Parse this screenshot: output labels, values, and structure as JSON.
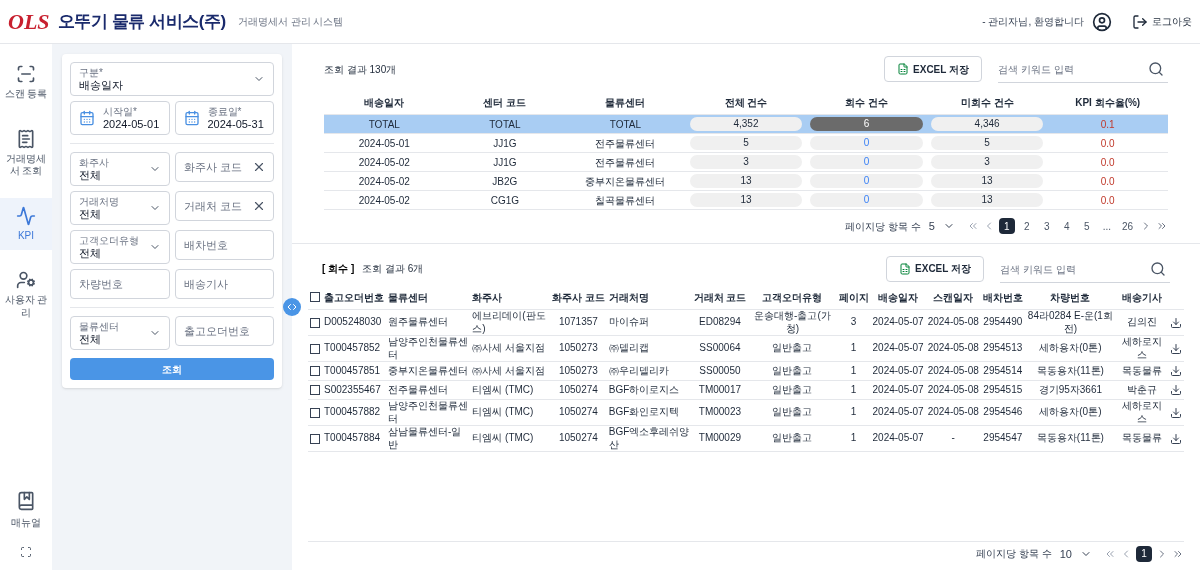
{
  "header": {
    "brand": "OLS",
    "company": "오뚜기 물류 서비스(주)",
    "subtitle": "거래명세서 관리 시스템",
    "welcome": "- 관리자님, 환영합니다",
    "logout": "로그아웃"
  },
  "nav": [
    {
      "label": "스캔 등록",
      "selected": false
    },
    {
      "label": "거래명세서 조회",
      "selected": false
    },
    {
      "label": "KPI",
      "selected": true
    },
    {
      "label": "사용자 관리",
      "selected": false
    }
  ],
  "nav_bottom": {
    "label": "매뉴얼"
  },
  "filters": {
    "groups": [
      [
        {
          "kind": "select",
          "label": "구분*",
          "value": "배송일자",
          "full": true
        },
        {
          "kind": "date",
          "label": "시작일*",
          "value": "2024-05-01"
        },
        {
          "kind": "date",
          "label": "종료일*",
          "value": "2024-05-31"
        }
      ],
      [
        {
          "kind": "select",
          "label": "화주사",
          "value": "전체"
        },
        {
          "kind": "input",
          "placeholder": "화주사 코드",
          "clearable": true
        },
        {
          "kind": "select",
          "label": "거래처명",
          "value": "전체"
        },
        {
          "kind": "input",
          "placeholder": "거래처 코드",
          "clearable": true
        },
        {
          "kind": "select",
          "label": "고객오더유형",
          "value": "전체"
        },
        {
          "kind": "input",
          "placeholder": "배차번호",
          "clearable": false
        },
        {
          "kind": "input",
          "placeholder": "차량번호",
          "clearable": false
        },
        {
          "kind": "input",
          "placeholder": "배송기사",
          "clearable": false
        }
      ],
      [
        {
          "kind": "select",
          "label": "물류센터",
          "value": "전체"
        },
        {
          "kind": "input",
          "placeholder": "출고오더번호",
          "clearable": false
        }
      ]
    ],
    "button": "조회"
  },
  "summary": {
    "result": "조회 결과 130개",
    "excel": "EXCEL 저장",
    "search_placeholder": "검색 키워드 입력",
    "columns": [
      "배송일자",
      "센터 코드",
      "물류센터",
      "전체 건수",
      "회수 건수",
      "미회수 건수",
      "KPI 회수율(%)"
    ],
    "rows": [
      {
        "selected": true,
        "cells": [
          "TOTAL",
          "TOTAL",
          "TOTAL",
          "4,352",
          "6",
          "4,346",
          "0.1"
        ]
      },
      {
        "selected": false,
        "cells": [
          "2024-05-01",
          "JJ1G",
          "전주물류센터",
          "5",
          "0",
          "5",
          "0.0"
        ]
      },
      {
        "selected": false,
        "cells": [
          "2024-05-02",
          "JJ1G",
          "전주물류센터",
          "3",
          "0",
          "3",
          "0.0"
        ]
      },
      {
        "selected": false,
        "cells": [
          "2024-05-02",
          "JB2G",
          "중부지온물류센터",
          "13",
          "0",
          "13",
          "0.0"
        ]
      },
      {
        "selected": false,
        "cells": [
          "2024-05-02",
          "CG1G",
          "칠곡물류센터",
          "13",
          "0",
          "13",
          "0.0"
        ]
      }
    ],
    "pagination": {
      "per_page_label": "페이지당 항목 수",
      "per_page": "5",
      "pages": [
        {
          "label": "1",
          "selected": true
        },
        {
          "label": "2",
          "selected": false
        },
        {
          "label": "3",
          "selected": false
        },
        {
          "label": "4",
          "selected": false
        },
        {
          "label": "5",
          "selected": false
        },
        {
          "label": "...",
          "selected": false
        },
        {
          "label": "26",
          "selected": false
        }
      ]
    }
  },
  "detail": {
    "tag": "[ 회수 ]",
    "result": "조회 결과 6개",
    "excel": "EXCEL 저장",
    "search_placeholder": "검색 키워드 입력",
    "select_all_checked": false,
    "columns": [
      "출고오더번호",
      "물류센터",
      "화주사",
      "화주사 코드",
      "거래처명",
      "거래처 코드",
      "고객오더유형",
      "페이지",
      "배송일자",
      "스캔일자",
      "배차번호",
      "차량번호",
      "배송기사"
    ],
    "rows": [
      {
        "checked": false,
        "cells": [
          "D005248030",
          "원주물류센터",
          "에브리데이(판도스)",
          "1071357",
          "마이슈퍼",
          "ED08294",
          "운송대행-출고(가청)",
          "3",
          "2024-05-07",
          "2024-05-08",
          "2954490",
          "84라0284 E-운(1회전)",
          "김의진"
        ]
      },
      {
        "checked": false,
        "cells": [
          "T000457852",
          "남양주인천물류센터",
          "㈜사세 서울지점",
          "1050273",
          "㈜델리캡",
          "SS00064",
          "일반출고",
          "1",
          "2024-05-07",
          "2024-05-08",
          "2954513",
          "세하용차(0톤)",
          "세하로지스"
        ]
      },
      {
        "checked": false,
        "cells": [
          "T000457851",
          "중부지온물류센터",
          "㈜사세 서울지점",
          "1050273",
          "㈜우리델리카",
          "SS00050",
          "일반출고",
          "1",
          "2024-05-07",
          "2024-05-08",
          "2954514",
          "목동용차(11톤)",
          "목동물류"
        ]
      },
      {
        "checked": false,
        "cells": [
          "S002355467",
          "전주물류센터",
          "티엠씨 (TMC)",
          "1050274",
          "BGF하이로지스",
          "TM00017",
          "일반출고",
          "1",
          "2024-05-07",
          "2024-05-08",
          "2954515",
          "경기95자3661",
          "박춘규"
        ]
      },
      {
        "checked": false,
        "cells": [
          "T000457882",
          "남양주인천물류센터",
          "티엠씨 (TMC)",
          "1050274",
          "BGF화인로지텍",
          "TM00023",
          "일반출고",
          "1",
          "2024-05-07",
          "2024-05-08",
          "2954546",
          "세하용차(0톤)",
          "세하로지스"
        ]
      },
      {
        "checked": false,
        "cells": [
          "T000457884",
          "삼남물류센터-일반",
          "티엠씨 (TMC)",
          "1050274",
          "BGF엑소후레쉬양산",
          "TM00029",
          "일반출고",
          "1",
          "2024-05-07",
          "-",
          "2954547",
          "목동용차(11톤)",
          "목동물류"
        ]
      }
    ],
    "pagination": {
      "per_page_label": "페이지당 항목 수",
      "per_page": "10",
      "pages": [
        {
          "label": "1",
          "selected": true
        }
      ]
    }
  }
}
